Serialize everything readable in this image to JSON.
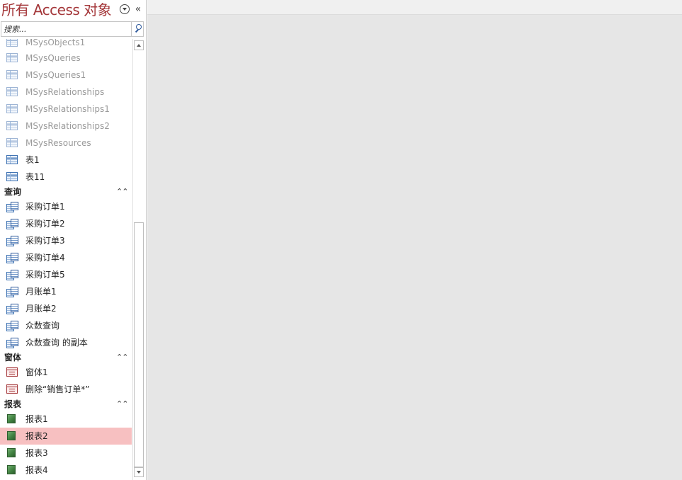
{
  "nav": {
    "title": "所有 Access 对象",
    "collapse_glyph": "«",
    "search": {
      "placeholder": "搜索..."
    }
  },
  "tables_items": [
    {
      "label": "MSysObjects1",
      "system": true,
      "icon": "table-icon"
    },
    {
      "label": "MSysQueries",
      "system": true,
      "icon": "table-icon"
    },
    {
      "label": "MSysQueries1",
      "system": true,
      "icon": "table-icon"
    },
    {
      "label": "MSysRelationships",
      "system": true,
      "icon": "table-icon"
    },
    {
      "label": "MSysRelationships1",
      "system": true,
      "icon": "table-icon"
    },
    {
      "label": "MSysRelationships2",
      "system": true,
      "icon": "table-icon"
    },
    {
      "label": "MSysResources",
      "system": true,
      "icon": "table-icon"
    },
    {
      "label": "表1",
      "system": false,
      "icon": "table-icon"
    },
    {
      "label": "表11",
      "system": false,
      "icon": "table-icon"
    }
  ],
  "groups": {
    "queries": {
      "label": "查询",
      "chevron": "⌃⌃",
      "items": [
        "采购订单1",
        "采购订单2",
        "采购订单3",
        "采购订单4",
        "采购订单5",
        "月账单1",
        "月账单2",
        "众数查询",
        "众数查询 的副本"
      ]
    },
    "forms": {
      "label": "窗体",
      "chevron": "⌃⌃",
      "items": [
        "窗体1",
        "删除“销售订单*”"
      ]
    },
    "reports": {
      "label": "报表",
      "chevron": "⌃⌃",
      "items": [
        "报表1",
        "报表2",
        "报表3",
        "报表4"
      ],
      "selected": "报表2"
    }
  },
  "colors": {
    "title": "#a4373a",
    "selection": "#f7c0c1",
    "workspace": "#e6e6e6"
  }
}
